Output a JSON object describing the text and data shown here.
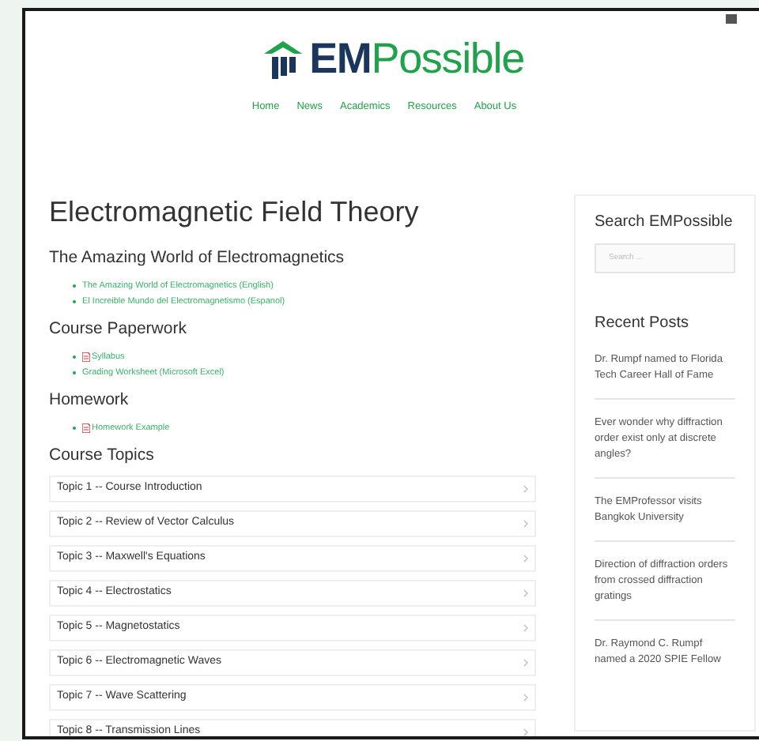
{
  "logo": {
    "part_1": "EM",
    "part_2": "Possible"
  },
  "nav": [
    "Home",
    "News",
    "Academics",
    "Resources",
    "About Us"
  ],
  "page_title": "Electromagnetic Field Theory",
  "sections": [
    {
      "heading": "The Amazing World of Electromagnetics",
      "links": [
        {
          "kind": "link",
          "text": "The Amazing World of Electromagnetics (English)"
        },
        {
          "kind": "link",
          "text": "El Increible Mundo del Electromagnetismo (Espanol)"
        }
      ]
    },
    {
      "heading": "Course Paperwork",
      "links": [
        {
          "kind": "pdf",
          "text": "Syllabus"
        },
        {
          "kind": "link",
          "text": "Grading Worksheet (Microsoft Excel)"
        }
      ]
    },
    {
      "heading": "Homework",
      "links": [
        {
          "kind": "pdf",
          "text": "Homework Example"
        }
      ]
    }
  ],
  "topics_heading": "Course Topics",
  "topics": [
    "Topic 1 -- Course Introduction",
    "Topic 2 -- Review of Vector Calculus",
    "Topic 3 -- Maxwell's Equations",
    "Topic 4 -- Electrostatics",
    "Topic 5 -- Magnetostatics",
    "Topic 6 -- Electromagnetic Waves",
    "Topic 7 -- Wave Scattering",
    "Topic 8 -- Transmission Lines"
  ],
  "sidebar": {
    "search_title": "Search EMPossible",
    "search": {
      "placeholder": "Search ..."
    },
    "recent_title": "Recent Posts",
    "posts": [
      "Dr. Rumpf named to Florida Tech Career Hall of Fame",
      "Ever wonder why diffraction order exist only at discrete angles?",
      "The EMProfessor visits Bangkok University",
      "Direction of diffraction orders from crossed diffraction gratings",
      "Dr. Raymond C. Rumpf named a 2020 SPIE Fellow"
    ]
  }
}
